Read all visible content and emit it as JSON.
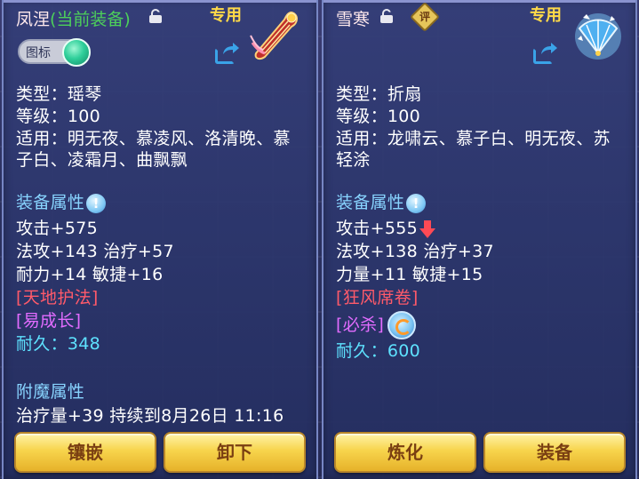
{
  "left_item": {
    "name": "凤涅",
    "status": "(当前装备)",
    "special_tag": "专用",
    "toggle_label": "图标",
    "type_line": "类型：瑶琴",
    "level_line": "等级：100",
    "applicable_line1": "适用：明无夜、慕凌风、洛清晚、慕",
    "applicable_line2": "子白、凌霜月、曲飘飘",
    "attr_title": "装备属性",
    "attack": "攻击+575",
    "magic_heal": "法攻+143 治疗+57",
    "endurance_agility": "耐力+14 敏捷+16",
    "skill1": "[天地护法]",
    "skill2": "[易成长]",
    "durability": "耐久：348",
    "enchant_title": "附魔属性",
    "enchant_line": "治疗量+39 持续到8月26日 11:16",
    "buttons": [
      "镶嵌",
      "卸下"
    ]
  },
  "right_item": {
    "name": "雪寒",
    "eval_badge": "评",
    "special_tag": "专用",
    "type_line": "类型：折扇",
    "level_line": "等级：100",
    "applicable_line1": "适用：龙啸云、慕子白、明无夜、苏",
    "applicable_line2": "轻涂",
    "attr_title": "装备属性",
    "attack": "攻击+555",
    "magic_heal": "法攻+138 治疗+37",
    "strength_agility": "力量+11 敏捷+15",
    "skill1": "[狂风席卷]",
    "skill2": "[必杀]",
    "durability": "耐久：600",
    "buttons": [
      "炼化",
      "装备"
    ]
  },
  "colors": {
    "accent_gold": "#ffd948",
    "status_green": "#4dd05a",
    "section_blue": "#88d4ff",
    "skill_red": "#ff5a6a",
    "skill_purple": "#e26cff",
    "durability_cyan": "#5ee2ff",
    "stat_down_red": "#ff4a55"
  }
}
